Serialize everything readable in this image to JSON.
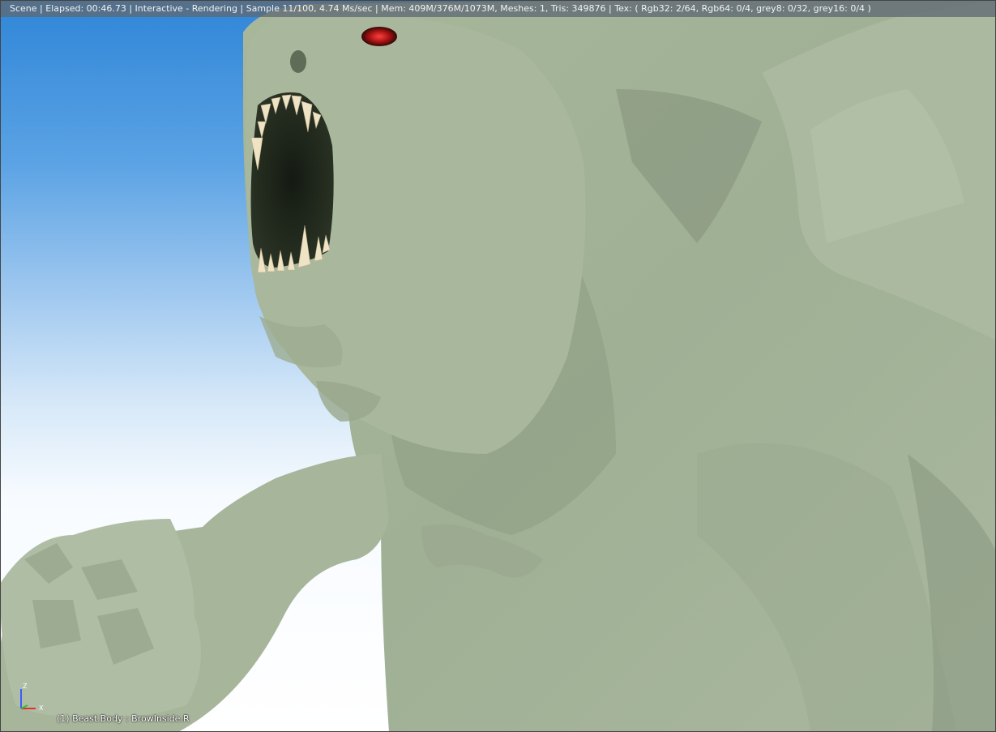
{
  "header": {
    "status_text": "Scene | Elapsed: 00:46.73 | Interactive - Rendering | Sample 11/100, 4.74 Ms/sec | Mem: 409M/376M/1073M, Meshes: 1, Tris: 349876 | Tex: ( Rgb32: 2/64, Rgb64: 0/4, grey8: 0/32, grey16: 0/4 )"
  },
  "viewport": {
    "object_label": "(1) Beast.Body : BrowInside.R",
    "axis": {
      "z": "Z",
      "x": "X"
    },
    "colors": {
      "sky_top": "#2f86d8",
      "creature": "#a9b79b",
      "header_bg": "#5f6973"
    }
  }
}
